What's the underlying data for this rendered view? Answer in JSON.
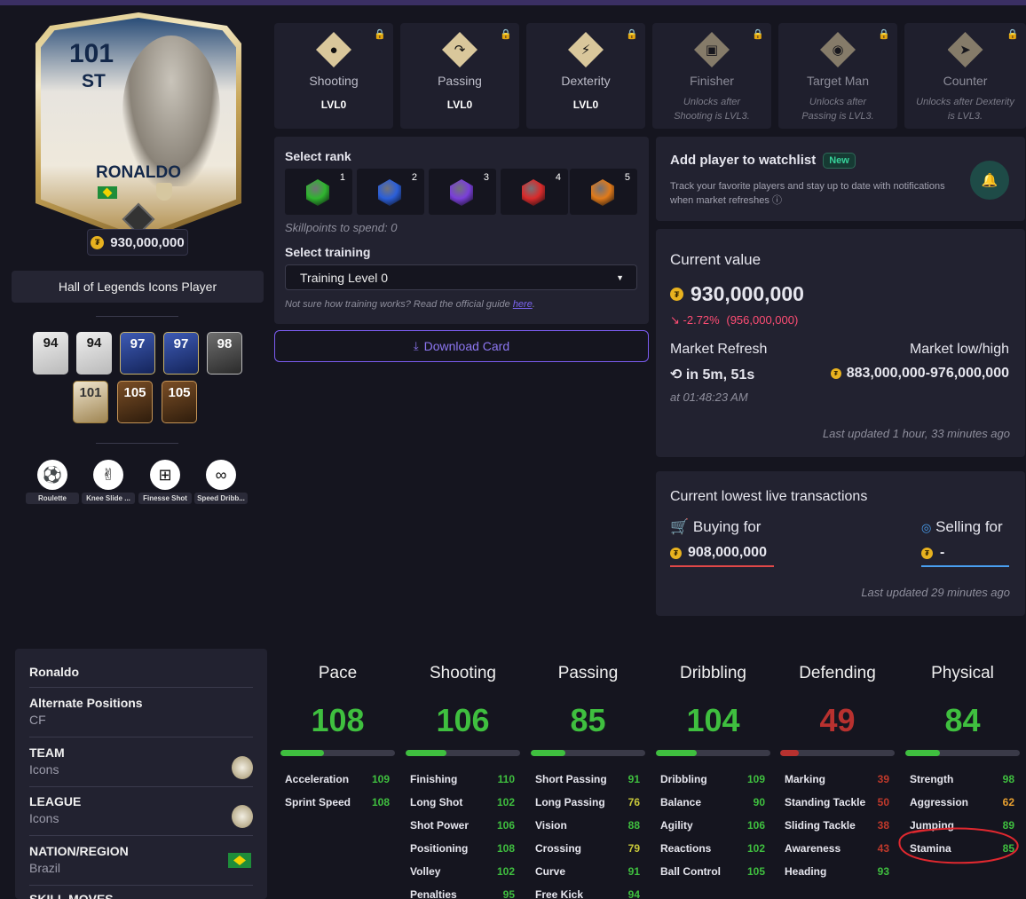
{
  "player": {
    "rating": "101",
    "position": "ST",
    "name": "RONALDO",
    "price": "930,000,000",
    "program": "Hall of Legends Icons Player"
  },
  "versions": [
    "94",
    "94",
    "97",
    "97",
    "98",
    "101",
    "105",
    "105"
  ],
  "skill_moves": [
    "Roulette",
    "Knee Slide ...",
    "Finesse Shot",
    "Speed Dribb..."
  ],
  "playstyles": [
    {
      "name": "Shooting",
      "level": "LVL0",
      "icon": "ball-burst-icon",
      "locked": false
    },
    {
      "name": "Passing",
      "level": "LVL0",
      "icon": "curved-arrow-icon",
      "locked": false
    },
    {
      "name": "Dexterity",
      "level": "LVL0",
      "icon": "lightning-icon",
      "locked": false
    },
    {
      "name": "Finisher",
      "note": "Unlocks after Shooting is LVL3.",
      "icon": "target-screen-icon",
      "locked": true
    },
    {
      "name": "Target Man",
      "note": "Unlocks after Passing is LVL3.",
      "icon": "location-pin-icon",
      "locked": true
    },
    {
      "name": "Counter",
      "note": "Unlocks after Dexterity is LVL3.",
      "icon": "runner-icon",
      "locked": true
    }
  ],
  "rank": {
    "title": "Select rank",
    "ranks": [
      {
        "num": "1",
        "color": "#2fb52f"
      },
      {
        "num": "2",
        "color": "#2b5fd9"
      },
      {
        "num": "3",
        "color": "#7a3fd9"
      },
      {
        "num": "4",
        "color": "#d92b2b"
      },
      {
        "num": "5",
        "color": "#e07a1a"
      }
    ],
    "skillpoints": "Skillpoints to spend: 0"
  },
  "training": {
    "title": "Select training",
    "selected": "Training Level 0",
    "guide_text": "Not sure how training works? Read the official guide",
    "guide_link": "here",
    "guide_end": "."
  },
  "download_label": "Download Card",
  "watchlist": {
    "title": "Add player to watchlist",
    "badge": "New",
    "description": "Track your favorite players and stay up to date with notifications when market refreshes"
  },
  "value": {
    "title": "Current value",
    "amount": "930,000,000",
    "change": "-2.72%",
    "previous": "(956,000,000)",
    "refresh_label": "Market Refresh",
    "refresh_in": "in 5m, 51s",
    "refresh_at": "at 01:48:23 AM",
    "lowhigh_label": "Market low/high",
    "lowhigh": "883,000,000-976,000,000",
    "updated": "Last updated 1 hour, 33 minutes ago"
  },
  "transactions": {
    "title": "Current lowest live transactions",
    "buy_label": "Buying for",
    "buy_value": "908,000,000",
    "sell_label": "Selling for",
    "sell_value": "-",
    "updated": "Last updated 29 minutes ago"
  },
  "info": {
    "name": "Ronaldo",
    "alt_pos_label": "Alternate Positions",
    "alt_pos": "CF",
    "team_label": "TEAM",
    "team": "Icons",
    "league_label": "LEAGUE",
    "league": "Icons",
    "nation_label": "NATION/REGION",
    "nation": "Brazil",
    "skill_label": "SKILL MOVES"
  },
  "stats": [
    {
      "name": "Pace",
      "value": "108",
      "fill": 0.38,
      "color": "#3fbf3f",
      "subs": [
        [
          "Acceleration",
          "109",
          "green"
        ],
        [
          "Sprint Speed",
          "108",
          "green"
        ]
      ]
    },
    {
      "name": "Shooting",
      "value": "106",
      "fill": 0.36,
      "color": "#3fbf3f",
      "subs": [
        [
          "Finishing",
          "110",
          "green"
        ],
        [
          "Long Shot",
          "102",
          "green"
        ],
        [
          "Shot Power",
          "106",
          "green"
        ],
        [
          "Positioning",
          "108",
          "green"
        ],
        [
          "Volley",
          "102",
          "green"
        ],
        [
          "Penalties",
          "95",
          "green"
        ]
      ]
    },
    {
      "name": "Passing",
      "value": "85",
      "fill": 0.3,
      "color": "#3fbf3f",
      "subs": [
        [
          "Short Passing",
          "91",
          "green"
        ],
        [
          "Long Passing",
          "76",
          "yellow"
        ],
        [
          "Vision",
          "88",
          "green"
        ],
        [
          "Crossing",
          "79",
          "yellow"
        ],
        [
          "Curve",
          "91",
          "green"
        ],
        [
          "Free Kick",
          "94",
          "green"
        ]
      ]
    },
    {
      "name": "Dribbling",
      "value": "104",
      "fill": 0.36,
      "color": "#3fbf3f",
      "subs": [
        [
          "Dribbling",
          "109",
          "green"
        ],
        [
          "Balance",
          "90",
          "green"
        ],
        [
          "Agility",
          "106",
          "green"
        ],
        [
          "Reactions",
          "102",
          "green"
        ],
        [
          "Ball Control",
          "105",
          "green"
        ]
      ]
    },
    {
      "name": "Defending",
      "value": "49",
      "fill": 0.16,
      "color": "#b8312f",
      "subs": [
        [
          "Marking",
          "39",
          "dred"
        ],
        [
          "Standing Tackle",
          "50",
          "dred"
        ],
        [
          "Sliding Tackle",
          "38",
          "dred"
        ],
        [
          "Awareness",
          "43",
          "dred"
        ],
        [
          "Heading",
          "93",
          "green"
        ]
      ]
    },
    {
      "name": "Physical",
      "value": "84",
      "fill": 0.3,
      "color": "#3fbf3f",
      "subs": [
        [
          "Strength",
          "98",
          "green"
        ],
        [
          "Aggression",
          "62",
          "orange"
        ],
        [
          "Jumping",
          "89",
          "green"
        ],
        [
          "Stamina",
          "85",
          "green"
        ]
      ]
    }
  ]
}
